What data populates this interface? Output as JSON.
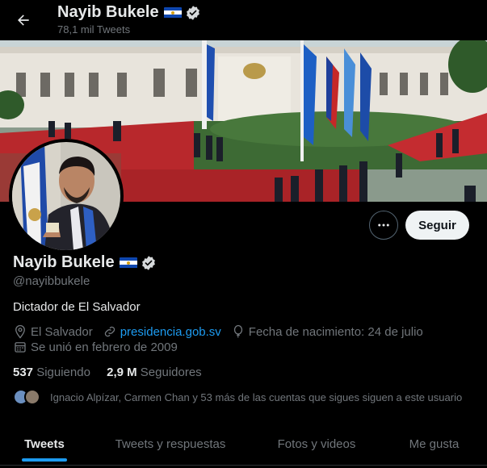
{
  "header": {
    "back_icon": "arrow-left-icon",
    "title": "Nayib Bukele",
    "tweet_count": "78,1 mil Tweets"
  },
  "profile": {
    "name": "Nayib Bukele",
    "handle": "@nayibbukele",
    "bio": "Dictador de El Salvador",
    "location": "El Salvador",
    "website": "presidencia.gob.sv",
    "birthday": "Fecha de nacimiento: 24 de julio",
    "joined": "Se unió en febrero de 2009",
    "following_count": "537",
    "following_label": "Siguiendo",
    "followers_count": "2,9 M",
    "followers_label": "Seguidores",
    "followed_by_text": "Ignacio Alpízar, Carmen Chan y 53 más de las cuentas que sigues siguen a este usuario"
  },
  "actions": {
    "more_icon": "ellipsis-icon",
    "follow_label": "Seguir"
  },
  "tabs": [
    {
      "label": "Tweets",
      "active": true
    },
    {
      "label": "Tweets y respuestas",
      "active": false
    },
    {
      "label": "Fotos y videos",
      "active": false
    },
    {
      "label": "Me gusta",
      "active": false
    }
  ],
  "colors": {
    "background": "#000000",
    "accent": "#1d9bf0",
    "text": "#e7e9ea",
    "muted": "#71767b"
  }
}
